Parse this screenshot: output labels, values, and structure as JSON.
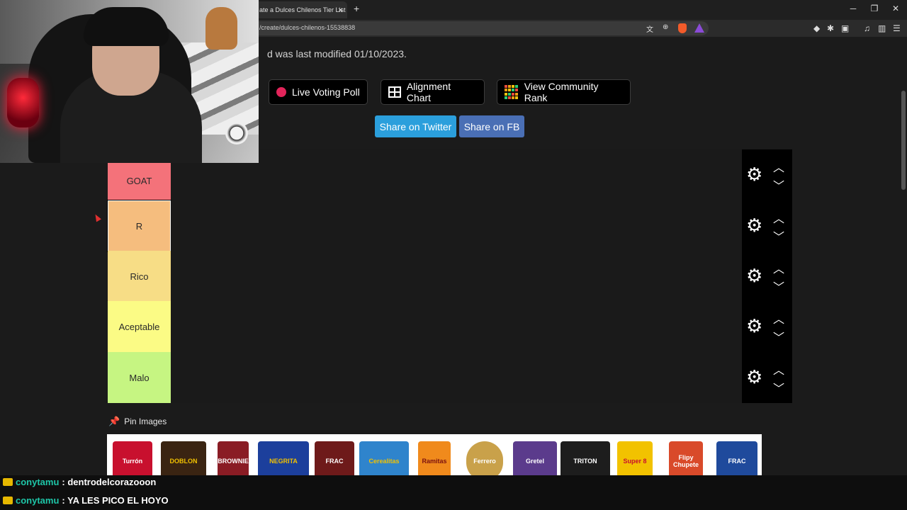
{
  "browser": {
    "tab_title": "ate a Dulces Chilenos Tier List",
    "tab_close": "×",
    "new_tab": "+",
    "url": "/create/dulces-chilenos-15538838",
    "win_min": "─",
    "win_max": "❐",
    "win_close": "✕"
  },
  "page": {
    "modified_text": "d was last modified 01/10/2023.",
    "buttons": {
      "live_poll": "Live Voting Poll",
      "alignment": "Alignment Chart",
      "community": "View Community Rank",
      "share_twitter": "Share on Twitter",
      "share_fb": "Share on FB"
    },
    "colors": {
      "twitter": "#2b9fdc",
      "fb": "#4a6fb5"
    }
  },
  "tiers": [
    {
      "label": "GOAT",
      "color": "#f4727a"
    },
    {
      "label": "R",
      "color": "#f5bd7e"
    },
    {
      "label": "Rico",
      "color": "#f7dd86"
    },
    {
      "label": "Aceptable",
      "color": "#fbfb85"
    },
    {
      "label": "Malo",
      "color": "#c6f582"
    }
  ],
  "pin_images": {
    "label": "Pin Images",
    "candies": [
      {
        "name": "Turrón",
        "color": "#c8102e"
      },
      {
        "name": "DOBLON",
        "color": "#3a2412"
      },
      {
        "name": "BROWNIE",
        "color": "#8a1c24"
      },
      {
        "name": "NEGRITA",
        "color": "#1c3f9c"
      },
      {
        "name": "FRAC",
        "color": "#6e1a1a"
      },
      {
        "name": "Cerealitas",
        "color": "#2f84cc"
      },
      {
        "name": "Ramitas",
        "color": "#f08a1c"
      },
      {
        "name": "Ferrero",
        "color": "#c9a14a"
      },
      {
        "name": "Gretel",
        "color": "#5b3b8c"
      },
      {
        "name": "TRITON",
        "color": "#1d1d1d"
      },
      {
        "name": "Super 8",
        "color": "#f2c200"
      },
      {
        "name": "Flipy Chupete",
        "color": "#d94a2a"
      },
      {
        "name": "FRAC",
        "color": "#1f4a9c"
      }
    ]
  },
  "chat": [
    {
      "user": "conytamu",
      "message": ": dentrodelcorazooon"
    },
    {
      "user": "conytamu",
      "message": ": YA LES PICO EL HOYO"
    }
  ]
}
